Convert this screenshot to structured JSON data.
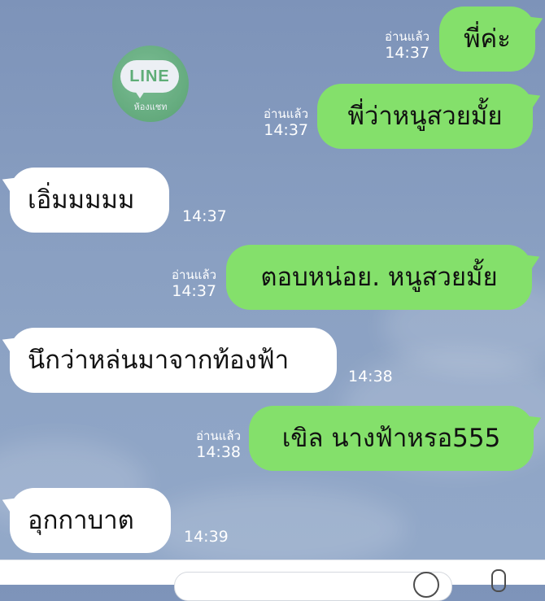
{
  "watermark": {
    "logo_text": "LINE",
    "sub_text": "ห้องแชท"
  },
  "messages": [
    {
      "side": "sent",
      "text": "พี่ค่ะ",
      "read": "อ่านแล้ว",
      "time": "14:37"
    },
    {
      "side": "sent",
      "text": "พี่ว่าหนูสวยมั้ย",
      "read": "อ่านแล้ว",
      "time": "14:37"
    },
    {
      "side": "received",
      "text": "เอิ่มมมมม",
      "time": "14:37"
    },
    {
      "side": "sent",
      "text": "ตอบหน่อย. หนูสวยมั้ย",
      "read": "อ่านแล้ว",
      "time": "14:37"
    },
    {
      "side": "received",
      "text": "นึกว่าหล่นมาจากท้องฟ้า",
      "time": "14:38"
    },
    {
      "side": "sent",
      "text": "เขิล  นางฟ้าหรอ555",
      "read": "อ่านแล้ว",
      "time": "14:38"
    },
    {
      "side": "received",
      "text": "อุกกาบาต",
      "time": "14:39"
    }
  ],
  "colors": {
    "sent_bubble": "#84e06b",
    "received_bubble": "#ffffff",
    "background": "#8aa0c2",
    "meta_text": "#ffffff"
  },
  "icons": {
    "emoji": "emoji-icon",
    "mic": "mic-icon"
  }
}
